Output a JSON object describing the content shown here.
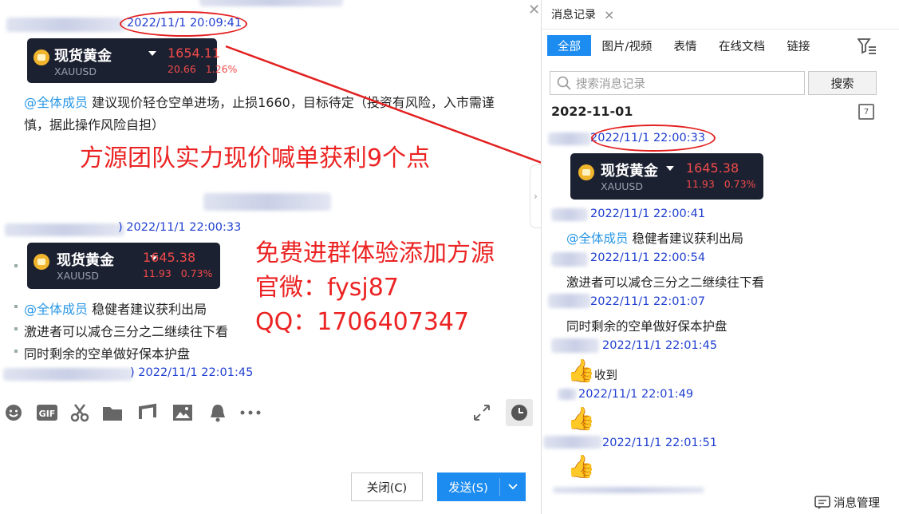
{
  "chat": {
    "msg1_time": "2022/11/1 20:09:41",
    "card1": {
      "name": "现货黄金",
      "code": "XAUUSD",
      "price": "1654.11",
      "change": "20.66",
      "change_pct": "1.26%"
    },
    "msg1_mention": "@全体成员",
    "msg1_text_line1": "建议现价轻仓空单进场，止损1660，目标待定（投资有风险，入市需谨",
    "msg1_text_line2": "慎，据此操作风险自担）",
    "overlay_headline": "方源团队实力现价喊单获利9个点",
    "msg2_time": ") 2022/11/1 22:00:33",
    "card2": {
      "name": "现货黄金",
      "code": "XAUUSD",
      "price": "1645.38",
      "change": "11.93",
      "change_pct": "0.73%"
    },
    "overlay_promo": "免费进群体验添加方源",
    "overlay_wechat": "官微：fysj87",
    "overlay_qq": "QQ：1706407347",
    "msg2_mention": "@全体成员",
    "msg2_line1": "稳健者建议获利出局",
    "msg2_line2": "激进者可以减仓三分之二继续往下看",
    "msg2_line3": "同时剩余的空单做好保本护盘",
    "msg3_time": ") 2022/11/1 22:01:45"
  },
  "toolbar": {
    "close_label": "关闭(C)",
    "send_label": "发送(S)"
  },
  "history": {
    "tab_title": "消息记录",
    "filters": [
      "全部",
      "图片/视频",
      "表情",
      "在线文档",
      "链接"
    ],
    "search_placeholder": "搜索消息记录",
    "search_button": "搜索",
    "date": "2022-11-01",
    "calendar_day": "7",
    "items": [
      {
        "time": "2022/11/1 22:00:33"
      },
      {
        "time": "2022/11/1 22:00:41",
        "mention": "@全体成员",
        "text": "稳健者建议获利出局"
      },
      {
        "time": "2022/11/1 22:00:54",
        "text": "激进者可以减仓三分之二继续往下看"
      },
      {
        "time": "2022/11/1 22:01:07",
        "text": "同时剩余的空单做好保本护盘"
      },
      {
        "time": "2022/11/1 22:01:45",
        "text": "收到"
      },
      {
        "time": "2022/11/1 22:01:49"
      },
      {
        "time": "2022/11/1 22:01:51"
      }
    ],
    "card": {
      "name": "现货黄金",
      "code": "XAUUSD",
      "price": "1645.38",
      "change": "11.93",
      "change_pct": "0.73%"
    },
    "manage_label": "消息管理"
  },
  "colors": {
    "accent": "#1d8cf0",
    "annotation_red": "#e32020",
    "timestamp_blue": "#1f3fd0",
    "card_bg": "#1c2131"
  }
}
